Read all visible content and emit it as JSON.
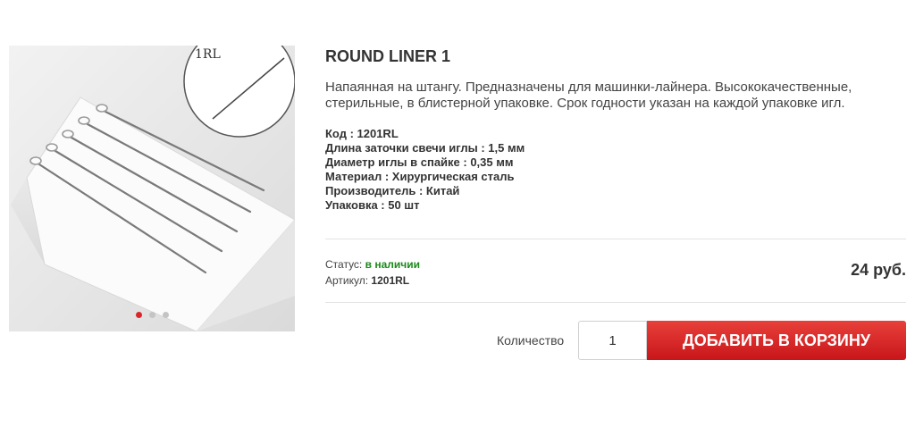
{
  "product": {
    "title": "ROUND LINER 1",
    "description": "Напаянная на штангу. Предназначены для машинки-лайнера. Высококачественные, стерильные, в блистерной упаковке. Срок годности указан на каждой упаковке игл.",
    "image_label": "1RL",
    "specs": [
      "Код : 1201RL",
      "Длина заточки свечи иглы : 1,5 мм",
      "Диаметр иглы в спайке : 0,35 мм",
      "Материал : Хирургическая сталь",
      "Производитель : Китай",
      "Упаковка : 50 шт"
    ],
    "status_label": "Статус:",
    "status_value": "в наличии",
    "article_label": "Артикул:",
    "article_value": "1201RL",
    "price": "24 руб."
  },
  "gallery": {
    "slide_count": 3,
    "active_slide": 1
  },
  "cart": {
    "quantity_label": "Количество",
    "quantity_value": "1",
    "add_button": "ДОБАВИТЬ В КОРЗИНУ"
  },
  "colors": {
    "accent": "#d8262a",
    "status_ok": "#1a8a1a"
  }
}
